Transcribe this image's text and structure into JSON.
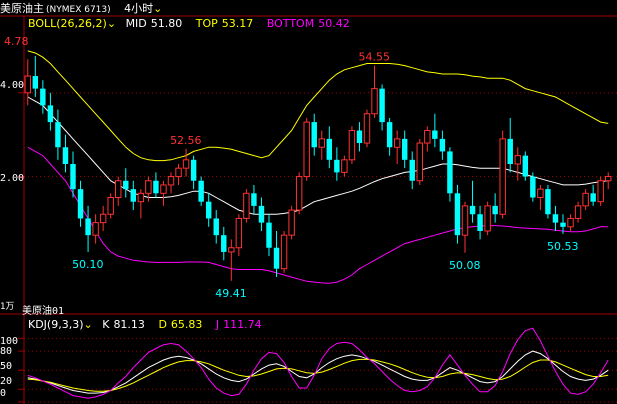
{
  "header": {
    "instrument": "美原油主",
    "code": "(NYMEX 6713)",
    "period": "4小时"
  },
  "boll": {
    "title": "BOLL(26,26,2)",
    "mid_label": "MID",
    "mid": "51.80",
    "top_label": "TOP",
    "top": "53.17",
    "bottom_label": "BOTTOM",
    "bottom": "50.42"
  },
  "kdj": {
    "title": "KDJ(9,3,3)",
    "k_label": "K",
    "k": "81.13",
    "d_label": "D",
    "d": "65.83",
    "j_label": "J",
    "j": "111.74"
  },
  "colors": {
    "up": "#ff3232",
    "down": "#00ffff",
    "mid": "#ffffff",
    "upper": "#ffff00",
    "lower": "#ff00ff",
    "k": "#ffffff",
    "d": "#ffff00",
    "j": "#ff00ff",
    "grid": "#a00000",
    "text": "#ffffff",
    "price_hi": "#ff3232",
    "price_lo": "#00ffff",
    "low_hi": "#00ffff"
  },
  "chart_data": [
    {
      "type": "candlestick",
      "title": "美原油主(NYMEX 6713) 4小时",
      "y_ticks": [
        "4.00",
        "2.00"
      ],
      "ylim": [
        49.0,
        55.4
      ],
      "annotations": [
        {
          "text": "4.78",
          "kind": "high"
        },
        {
          "text": "52.56",
          "kind": "high"
        },
        {
          "text": "54.55",
          "kind": "high"
        },
        {
          "text": "50.10",
          "kind": "low"
        },
        {
          "text": "49.41",
          "kind": "low"
        },
        {
          "text": "50.08",
          "kind": "low"
        },
        {
          "text": "50.53",
          "kind": "low"
        }
      ],
      "sub_label": "美原油01",
      "sub_label2": "1万",
      "candles": [
        [
          53.9,
          54.7,
          53.6,
          54.3
        ],
        [
          54.3,
          54.78,
          53.8,
          54.0
        ],
        [
          54.0,
          54.2,
          53.4,
          53.6
        ],
        [
          53.6,
          53.9,
          53.0,
          53.2
        ],
        [
          53.2,
          53.5,
          52.3,
          52.6
        ],
        [
          52.6,
          52.9,
          52.0,
          52.2
        ],
        [
          52.2,
          52.5,
          51.4,
          51.6
        ],
        [
          51.6,
          51.8,
          50.7,
          50.9
        ],
        [
          50.9,
          51.2,
          50.1,
          50.5
        ],
        [
          50.5,
          51.0,
          50.3,
          50.8
        ],
        [
          50.8,
          51.2,
          50.6,
          51.0
        ],
        [
          51.0,
          51.5,
          50.9,
          51.4
        ],
        [
          51.4,
          51.9,
          51.2,
          51.8
        ],
        [
          51.8,
          52.1,
          51.4,
          51.6
        ],
        [
          51.6,
          51.8,
          51.1,
          51.3
        ],
        [
          51.3,
          51.6,
          50.9,
          51.5
        ],
        [
          51.5,
          51.9,
          51.3,
          51.8
        ],
        [
          51.8,
          52.0,
          51.4,
          51.5
        ],
        [
          51.5,
          51.8,
          51.2,
          51.7
        ],
        [
          51.7,
          52.0,
          51.5,
          51.9
        ],
        [
          51.9,
          52.2,
          51.7,
          52.1
        ],
        [
          52.1,
          52.56,
          51.9,
          52.3
        ],
        [
          52.3,
          52.4,
          51.6,
          51.8
        ],
        [
          51.8,
          51.9,
          51.2,
          51.3
        ],
        [
          51.3,
          51.5,
          50.7,
          50.9
        ],
        [
          50.9,
          51.1,
          50.3,
          50.5
        ],
        [
          50.5,
          50.7,
          49.9,
          50.1
        ],
        [
          50.1,
          50.4,
          49.41,
          50.2
        ],
        [
          50.2,
          51.0,
          50.0,
          50.9
        ],
        [
          50.9,
          51.6,
          50.8,
          51.5
        ],
        [
          51.5,
          51.7,
          51.0,
          51.2
        ],
        [
          51.2,
          51.4,
          50.6,
          50.8
        ],
        [
          50.8,
          51.0,
          50.0,
          50.2
        ],
        [
          50.2,
          50.6,
          49.5,
          49.7
        ],
        [
          49.7,
          50.6,
          49.6,
          50.5
        ],
        [
          50.5,
          51.2,
          50.4,
          51.1
        ],
        [
          51.1,
          52.0,
          51.0,
          51.9
        ],
        [
          51.9,
          53.3,
          51.8,
          53.2
        ],
        [
          53.2,
          53.4,
          52.4,
          52.6
        ],
        [
          52.6,
          53.0,
          52.3,
          52.8
        ],
        [
          52.8,
          53.1,
          52.1,
          52.3
        ],
        [
          52.3,
          52.6,
          51.8,
          52.0
        ],
        [
          52.0,
          52.4,
          51.9,
          52.3
        ],
        [
          52.3,
          53.1,
          52.2,
          53.0
        ],
        [
          53.0,
          53.2,
          52.5,
          52.7
        ],
        [
          52.7,
          53.5,
          52.6,
          53.4
        ],
        [
          53.4,
          54.55,
          53.3,
          54.0
        ],
        [
          54.0,
          54.1,
          53.0,
          53.2
        ],
        [
          53.2,
          53.3,
          52.4,
          52.6
        ],
        [
          52.6,
          53.0,
          52.2,
          52.8
        ],
        [
          52.8,
          53.0,
          52.1,
          52.3
        ],
        [
          52.3,
          52.5,
          51.6,
          51.8
        ],
        [
          51.8,
          52.8,
          51.7,
          52.7
        ],
        [
          52.7,
          53.1,
          52.5,
          53.0
        ],
        [
          53.0,
          53.4,
          52.6,
          52.8
        ],
        [
          52.8,
          53.0,
          52.3,
          52.5
        ],
        [
          52.5,
          52.6,
          51.3,
          51.5
        ],
        [
          51.5,
          51.7,
          50.3,
          50.5
        ],
        [
          50.5,
          51.3,
          50.08,
          51.2
        ],
        [
          51.2,
          51.8,
          50.8,
          51.0
        ],
        [
          51.0,
          51.2,
          50.4,
          50.6
        ],
        [
          50.6,
          51.3,
          50.5,
          51.2
        ],
        [
          51.2,
          51.5,
          50.8,
          51.0
        ],
        [
          51.0,
          53.0,
          50.9,
          52.8
        ],
        [
          52.8,
          53.3,
          52.0,
          52.2
        ],
        [
          52.2,
          52.6,
          51.8,
          52.4
        ],
        [
          52.4,
          52.5,
          51.8,
          51.9
        ],
        [
          51.9,
          52.0,
          51.3,
          51.4
        ],
        [
          51.4,
          51.7,
          51.1,
          51.6
        ],
        [
          51.6,
          51.7,
          50.9,
          51.0
        ],
        [
          51.0,
          51.2,
          50.6,
          50.8
        ],
        [
          50.8,
          51.0,
          50.53,
          50.7
        ],
        [
          50.7,
          51.0,
          50.6,
          50.9
        ],
        [
          50.9,
          51.3,
          50.8,
          51.2
        ],
        [
          51.2,
          51.6,
          51.1,
          51.5
        ],
        [
          51.5,
          51.7,
          51.2,
          51.3
        ],
        [
          51.3,
          51.9,
          51.2,
          51.8
        ],
        [
          51.8,
          52.0,
          51.6,
          51.9
        ]
      ],
      "mid_series": [
        53.8,
        53.7,
        53.6,
        53.4,
        53.2,
        53.0,
        52.8,
        52.6,
        52.4,
        52.2,
        52.0,
        51.8,
        51.7,
        51.6,
        51.5,
        51.45,
        51.4,
        51.4,
        51.4,
        51.42,
        51.45,
        51.5,
        51.55,
        51.55,
        51.5,
        51.4,
        51.3,
        51.2,
        51.1,
        51.05,
        51.0,
        51.0,
        51.0,
        51.0,
        51.02,
        51.05,
        51.1,
        51.2,
        51.3,
        51.35,
        51.4,
        51.45,
        51.5,
        51.55,
        51.62,
        51.7,
        51.78,
        51.85,
        51.9,
        51.95,
        52.0,
        52.02,
        52.05,
        52.1,
        52.15,
        52.2,
        52.2,
        52.18,
        52.15,
        52.12,
        52.1,
        52.1,
        52.1,
        52.1,
        52.05,
        52.0,
        51.95,
        51.9,
        51.85,
        51.8,
        51.75,
        51.7,
        51.7,
        51.7,
        51.72,
        51.75,
        51.78,
        51.8
      ],
      "upper_series": [
        54.9,
        54.85,
        54.75,
        54.6,
        54.4,
        54.2,
        54.0,
        53.8,
        53.6,
        53.4,
        53.2,
        53.0,
        52.8,
        52.6,
        52.45,
        52.35,
        52.3,
        52.28,
        52.28,
        52.3,
        52.35,
        52.4,
        52.5,
        52.55,
        52.6,
        52.6,
        52.58,
        52.55,
        52.5,
        52.45,
        52.4,
        52.35,
        52.4,
        52.6,
        52.8,
        53.0,
        53.3,
        53.6,
        53.8,
        54.0,
        54.2,
        54.35,
        54.45,
        54.5,
        54.55,
        54.6,
        54.6,
        54.6,
        54.6,
        54.58,
        54.55,
        54.5,
        54.45,
        54.4,
        54.38,
        54.35,
        54.35,
        54.35,
        54.33,
        54.3,
        54.28,
        54.25,
        54.25,
        54.25,
        54.2,
        54.1,
        54.0,
        53.95,
        53.9,
        53.85,
        53.8,
        53.7,
        53.6,
        53.5,
        53.4,
        53.3,
        53.2,
        53.17
      ],
      "lower_series": [
        52.6,
        52.5,
        52.4,
        52.2,
        52.0,
        51.8,
        51.5,
        51.2,
        50.9,
        50.6,
        50.3,
        50.1,
        50.0,
        49.95,
        49.9,
        49.88,
        49.86,
        49.85,
        49.85,
        49.85,
        49.85,
        49.86,
        49.86,
        49.86,
        49.85,
        49.8,
        49.75,
        49.7,
        49.68,
        49.68,
        49.68,
        49.68,
        49.65,
        49.6,
        49.55,
        49.5,
        49.45,
        49.4,
        49.38,
        49.36,
        49.35,
        49.38,
        49.45,
        49.55,
        49.7,
        49.8,
        49.9,
        50.0,
        50.1,
        50.2,
        50.3,
        50.35,
        50.4,
        50.45,
        50.5,
        50.55,
        50.6,
        50.65,
        50.68,
        50.7,
        50.72,
        50.73,
        50.73,
        50.72,
        50.7,
        50.68,
        50.67,
        50.66,
        50.65,
        50.64,
        50.62,
        50.6,
        50.58,
        50.58,
        50.6,
        50.65,
        50.7,
        50.7
      ]
    },
    {
      "type": "line",
      "title": "KDJ(9,3,3)",
      "y_ticks": [
        "100",
        "80",
        "50",
        "20",
        "0"
      ],
      "ylim": [
        0,
        110
      ],
      "series": [
        {
          "name": "K",
          "values": [
            38,
            36,
            33,
            30,
            26,
            22,
            18,
            16,
            14,
            14,
            15,
            18,
            24,
            30,
            38,
            46,
            54,
            60,
            66,
            70,
            72,
            70,
            66,
            60,
            52,
            44,
            38,
            34,
            32,
            36,
            44,
            52,
            58,
            60,
            56,
            48,
            40,
            38,
            44,
            54,
            62,
            68,
            72,
            74,
            72,
            68,
            64,
            58,
            52,
            46,
            40,
            36,
            34,
            34,
            38,
            46,
            54,
            50,
            44,
            38,
            32,
            30,
            32,
            40,
            52,
            64,
            74,
            80,
            76,
            68,
            58,
            48,
            40,
            36,
            34,
            36,
            42,
            50
          ]
        },
        {
          "name": "D",
          "values": [
            36,
            35,
            33,
            31,
            28,
            25,
            22,
            20,
            18,
            17,
            17,
            18,
            21,
            25,
            30,
            36,
            42,
            48,
            54,
            59,
            63,
            65,
            65,
            63,
            60,
            55,
            50,
            46,
            42,
            40,
            41,
            44,
            48,
            52,
            53,
            52,
            49,
            46,
            45,
            47,
            51,
            56,
            61,
            65,
            67,
            67,
            66,
            63,
            60,
            56,
            51,
            46,
            42,
            39,
            38,
            40,
            44,
            46,
            45,
            43,
            40,
            37,
            35,
            36,
            40,
            47,
            55,
            62,
            66,
            66,
            63,
            58,
            53,
            48,
            43,
            40,
            40,
            42
          ]
        },
        {
          "name": "J",
          "values": [
            42,
            38,
            33,
            28,
            22,
            16,
            10,
            8,
            6,
            8,
            12,
            18,
            30,
            40,
            54,
            66,
            78,
            84,
            90,
            92,
            90,
            80,
            68,
            54,
            36,
            22,
            14,
            10,
            12,
            28,
            50,
            68,
            78,
            76,
            62,
            40,
            22,
            22,
            42,
            68,
            84,
            92,
            94,
            92,
            82,
            70,
            60,
            48,
            36,
            26,
            18,
            16,
            18,
            24,
            38,
            58,
            74,
            58,
            42,
            28,
            16,
            16,
            26,
            48,
            76,
            98,
            112,
            116,
            96,
            72,
            48,
            28,
            14,
            12,
            16,
            28,
            46,
            66
          ]
        }
      ]
    }
  ]
}
